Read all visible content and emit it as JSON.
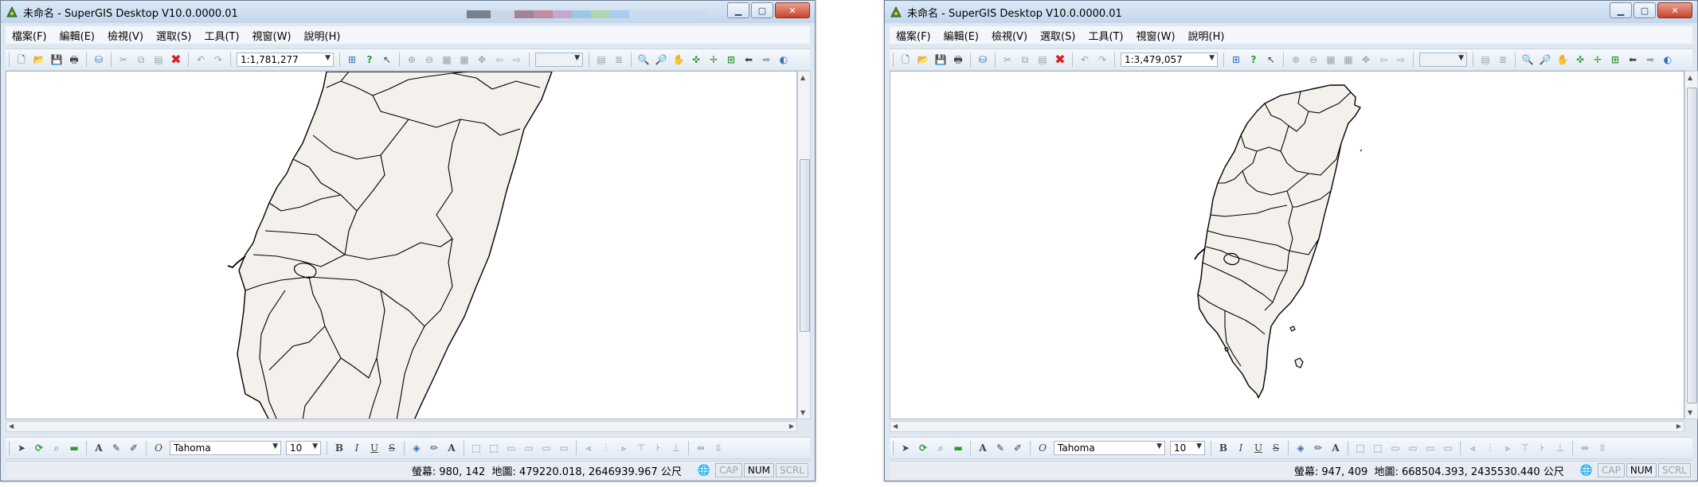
{
  "windows": [
    {
      "title": "未命名 - SuperGIS Desktop V10.0.0000.01",
      "menu": [
        "檔案(F)",
        "編輯(E)",
        "檢視(V)",
        "選取(S)",
        "工具(T)",
        "視窗(W)",
        "說明(H)"
      ],
      "scale": "1:1,781,277",
      "font_name": "Tahoma",
      "font_size": "10",
      "status": {
        "screen_coords": "螢幕: 980, 142",
        "map_coords": "地圖: 479220.018, 2646939.967 公尺",
        "cap": "CAP",
        "num": "NUM",
        "scrl": "SCRL"
      },
      "map": {
        "zoom_description": "zoomed-in",
        "fill_color": "#f4f1ec",
        "stroke_color": "#000000"
      }
    },
    {
      "title": "未命名 - SuperGIS Desktop V10.0.0000.01",
      "menu": [
        "檔案(F)",
        "編輯(E)",
        "檢視(V)",
        "選取(S)",
        "工具(T)",
        "視窗(W)",
        "說明(H)"
      ],
      "scale": "1:3,479,057",
      "font_name": "Tahoma",
      "font_size": "10",
      "status": {
        "screen_coords": "螢幕: 947, 409",
        "map_coords": "地圖: 668504.393, 2435530.440 公尺",
        "cap": "CAP",
        "num": "NUM",
        "scrl": "SCRL"
      },
      "map": {
        "zoom_description": "full-extent",
        "fill_color": "#f4f1ec",
        "stroke_color": "#000000"
      }
    }
  ],
  "icons": {
    "top_toolbar": [
      "new-icon",
      "open-icon",
      "save-icon",
      "print-icon",
      "add-data-icon",
      "cut-icon",
      "copy-icon",
      "paste-icon",
      "delete-icon",
      "undo-icon",
      "redo-icon",
      "identify-icon",
      "help-icon",
      "whats-this-icon",
      "zoom-in-fixed-icon",
      "zoom-out-fixed-icon",
      "select-icon",
      "zoom-in-icon",
      "zoom-out-icon",
      "pan-icon",
      "full-extent-icon",
      "previous-extent-icon",
      "next-extent-icon"
    ],
    "bottom_toolbar": [
      "select-pointer-icon",
      "rotate-icon",
      "zoom-icon",
      "rectangle-icon",
      "text-tool-icon",
      "pencil-icon",
      "highlight-icon",
      "font-icon",
      "bold-icon",
      "italic-icon",
      "underline-icon",
      "strikethrough-icon",
      "fill-color-icon",
      "line-color-icon",
      "font-color-icon",
      "align-left-icon",
      "align-center-icon",
      "align-right-icon"
    ]
  }
}
